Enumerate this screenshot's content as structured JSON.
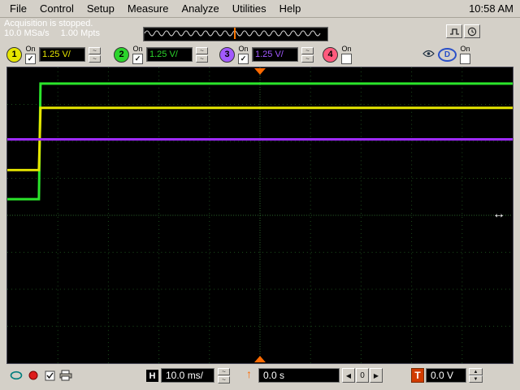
{
  "window": {
    "clock": "10:58 AM"
  },
  "menu": {
    "items": [
      "File",
      "Control",
      "Setup",
      "Measure",
      "Analyze",
      "Utilities",
      "Help"
    ]
  },
  "status": {
    "acquisition": "Acquisition is stopped.",
    "sample_rate": "10.0 MSa/s",
    "memory": "1.00 Mpts"
  },
  "channels": [
    {
      "num": "1",
      "on_label": "On",
      "on": true,
      "scale": "1.25 V/",
      "color": "#e6e600"
    },
    {
      "num": "2",
      "on_label": "On",
      "on": true,
      "scale": "1.25 V/",
      "color": "#2bd42b"
    },
    {
      "num": "3",
      "on_label": "On",
      "on": true,
      "scale": "1.25 V/",
      "color": "#a259ff"
    },
    {
      "num": "4",
      "on_label": "On",
      "on": false,
      "color": "#ff5a7d"
    }
  ],
  "digital": {
    "label": "D",
    "on_label": "On",
    "on": false,
    "color": "#2b50c8"
  },
  "horizontal": {
    "label": "H",
    "scale": "10.0 ms/",
    "position": "0.0 s",
    "zero_label": "0"
  },
  "trigger": {
    "label": "T",
    "level": "0.0 V",
    "label_bg": "#d23c00",
    "marker_color": "#ff6a00"
  },
  "glyphs": {
    "squiggle": "~",
    "left_arrow": "◀",
    "right_arrow": "▶",
    "up_arrow": "▲",
    "down_arrow": "▼",
    "trigger_position": "↑",
    "resize_cursor": "↔",
    "check": "✓"
  },
  "icons": [
    "pulse-icon",
    "clock-icon",
    "eye-icon",
    "ellipse-tool-icon",
    "record-dot-icon",
    "checklist-icon",
    "printer-icon",
    "trigger-position-icon",
    "resize-cursor-icon",
    "trigger-marker-top",
    "trigger-marker-bottom"
  ],
  "scope": {
    "grid": {
      "cols": 10,
      "rows": 8,
      "minor_color": "#1d4d1d",
      "axis_color": "#2f6e2f"
    },
    "traces": [
      {
        "channel": "2",
        "color": "#2be52b",
        "points": [
          [
            0,
            163
          ],
          [
            39,
            163
          ],
          [
            41,
            20
          ],
          [
            624,
            20
          ]
        ]
      },
      {
        "channel": "1",
        "color": "#e6e600",
        "points": [
          [
            0,
            127
          ],
          [
            39,
            127
          ],
          [
            41,
            50
          ],
          [
            624,
            50
          ]
        ]
      },
      {
        "channel": "3",
        "color": "#a02bff",
        "points": [
          [
            0,
            89
          ],
          [
            624,
            89
          ]
        ]
      }
    ]
  }
}
